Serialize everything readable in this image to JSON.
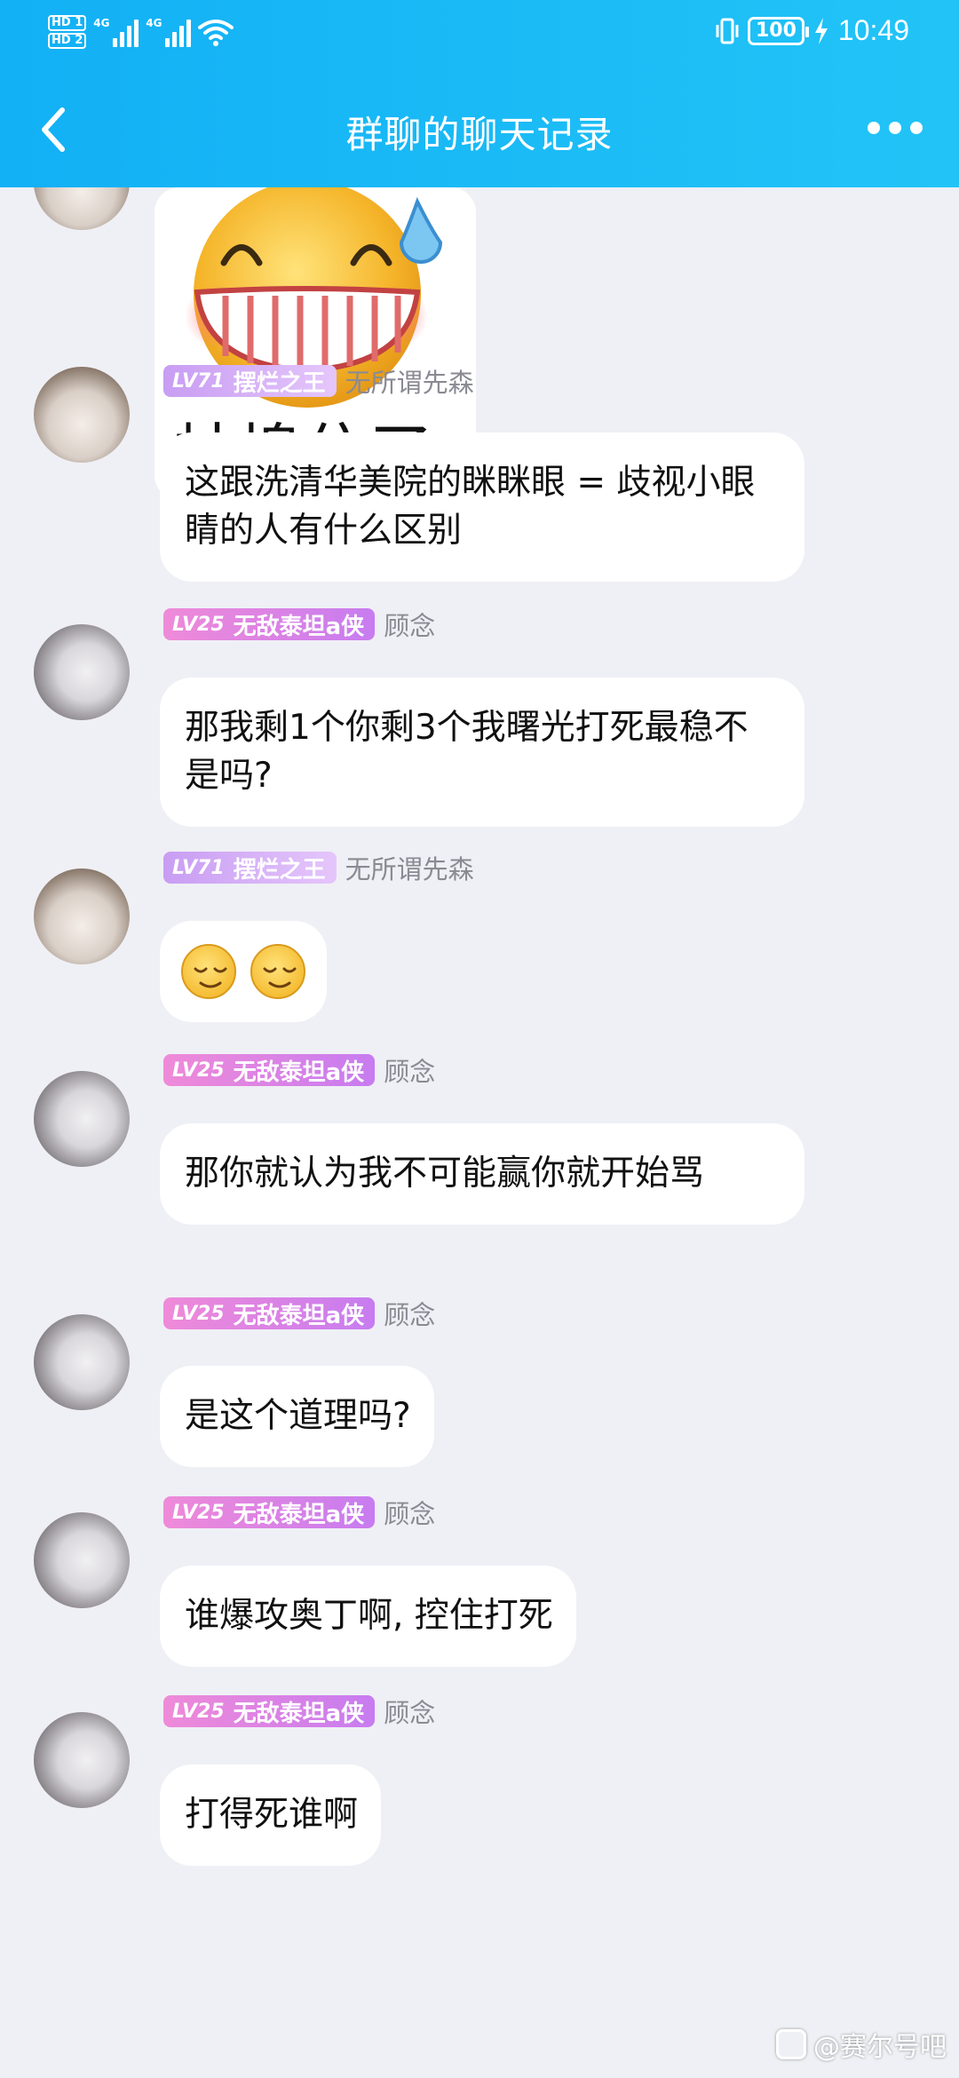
{
  "status_bar": {
    "hd1": "HD 1",
    "hd2": "HD 2",
    "net1": "4G",
    "net2": "4G",
    "battery": "100",
    "time": "10:49"
  },
  "nav": {
    "title": "群聊的聊天记录"
  },
  "sticker": {
    "caption": "蚌埠住了"
  },
  "messages": [
    {
      "level": "LV71",
      "title": "摆烂之王",
      "nickname": "无所谓先森",
      "text": "这跟洗清华美院的眯眯眼 = 歧视小眼睛的人有什么区别"
    },
    {
      "level": "LV25",
      "title": "无敌泰坦a侠",
      "nickname": "顾念",
      "text": "那我剩1个你剩3个我曙光打死最稳不是吗?"
    },
    {
      "level": "LV71",
      "title": "摆烂之王",
      "nickname": "无所谓先森",
      "text": ""
    },
    {
      "level": "LV25",
      "title": "无敌泰坦a侠",
      "nickname": "顾念",
      "text": "那你就认为我不可能赢你就开始骂"
    },
    {
      "level": "LV25",
      "title": "无敌泰坦a侠",
      "nickname": "顾念",
      "text": "是这个道理吗?"
    },
    {
      "level": "LV25",
      "title": "无敌泰坦a侠",
      "nickname": "顾念",
      "text": "谁爆攻奥丁啊, 控住打死"
    },
    {
      "level": "LV25",
      "title": "无敌泰坦a侠",
      "nickname": "顾念",
      "text": "打得死谁啊"
    }
  ],
  "watermark": "@赛尔号吧",
  "colors": {
    "header": "#18b8f6",
    "chat_bg": "#eff0f5",
    "badge_lv71": "#d3aef6",
    "badge_lv25": "#e08ae0"
  }
}
